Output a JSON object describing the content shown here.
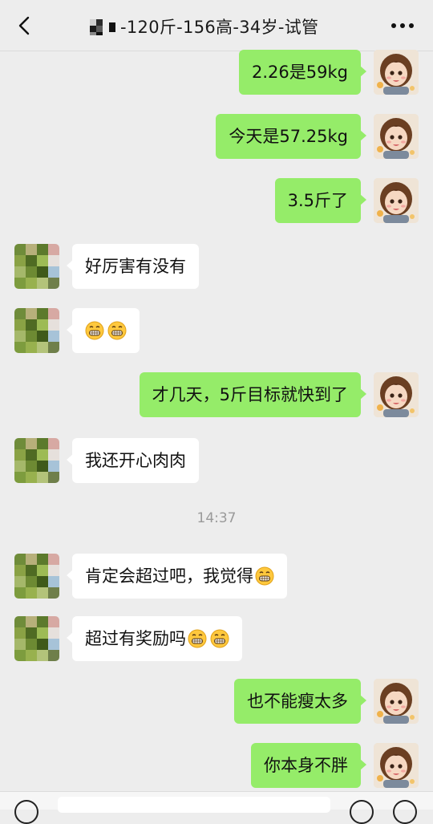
{
  "header": {
    "title": "-120斤-156高-34岁-试管",
    "back_icon": "chevron-left-icon",
    "more_icon": "ellipsis-icon"
  },
  "messages": [
    {
      "side": "me",
      "text": "2.26是59kg"
    },
    {
      "side": "me",
      "text": "今天是57.25kg"
    },
    {
      "side": "me",
      "text": "3.5斤了"
    },
    {
      "side": "other",
      "text": "好厉害有没有"
    },
    {
      "side": "other",
      "text": "",
      "emojis": 2
    },
    {
      "side": "me",
      "text": "才几天，5斤目标就快到了"
    },
    {
      "side": "other",
      "text": "我还开心肉肉"
    },
    {
      "side": "other",
      "text": "肯定会超过吧，我觉得",
      "emojis": 1
    },
    {
      "side": "other",
      "text": "超过有奖励吗",
      "emojis": 2
    },
    {
      "side": "me",
      "text": "也不能瘦太多"
    },
    {
      "side": "me",
      "text": "你本身不胖"
    }
  ],
  "timestamp": "14:37",
  "colors": {
    "background": "#ededed",
    "my_bubble": "#95ec69",
    "other_bubble": "#ffffff"
  }
}
